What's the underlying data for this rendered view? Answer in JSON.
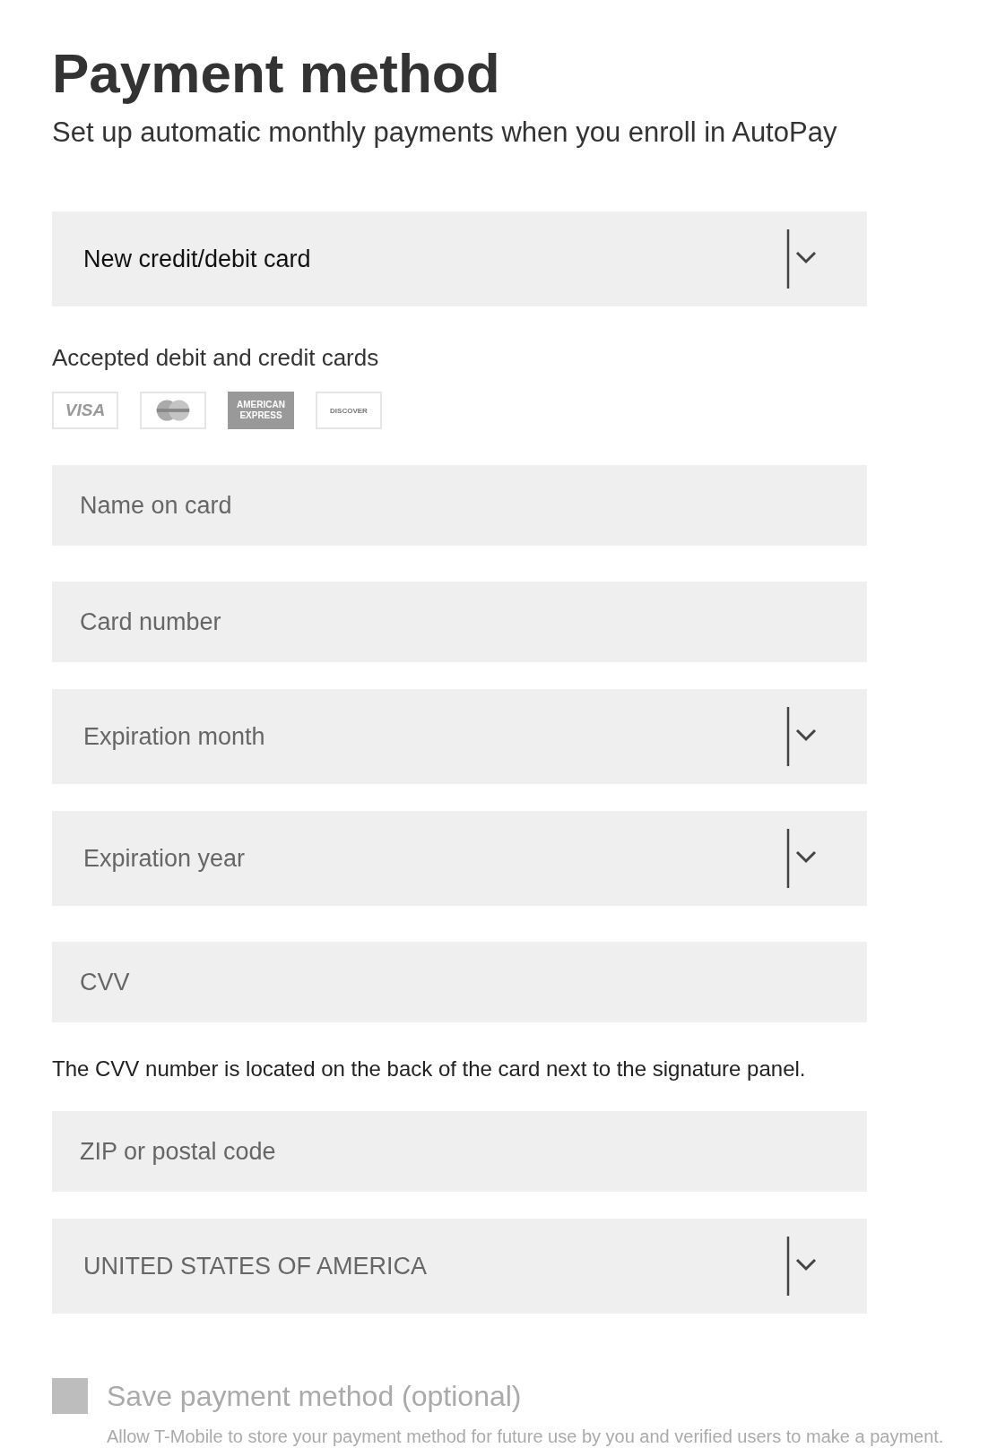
{
  "title": "Payment method",
  "subtitle": "Set up automatic monthly payments when you enroll in AutoPay",
  "payment_type": {
    "value": "New credit/debit card"
  },
  "accepted_cards": {
    "label": "Accepted debit and credit cards",
    "cards": [
      {
        "kind": "visa",
        "text": "VISA"
      },
      {
        "kind": "mastercard"
      },
      {
        "kind": "amex",
        "text": "AMERICAN EXPRESS"
      },
      {
        "kind": "discover",
        "text": "DISCOVER"
      }
    ]
  },
  "form_fields": [
    {
      "kind": "input",
      "placeholder": "Name on card"
    },
    {
      "kind": "input",
      "placeholder": "Card number"
    },
    {
      "kind": "select",
      "placeholder": "Expiration month"
    },
    {
      "kind": "select",
      "placeholder": "Expiration year"
    },
    {
      "kind": "input",
      "placeholder": "CVV"
    },
    {
      "kind": "note",
      "text": "The CVV number is located on the back of the card next to the signature panel."
    },
    {
      "kind": "input",
      "placeholder": "ZIP or postal code"
    },
    {
      "kind": "select",
      "placeholder": "UNITED STATES OF AMERICA"
    }
  ],
  "save_option": {
    "label": "Save payment method (optional)",
    "description": "Allow T-Mobile to store your payment method for future use by you and verified users to make a payment.",
    "checked": false,
    "disabled": true
  }
}
